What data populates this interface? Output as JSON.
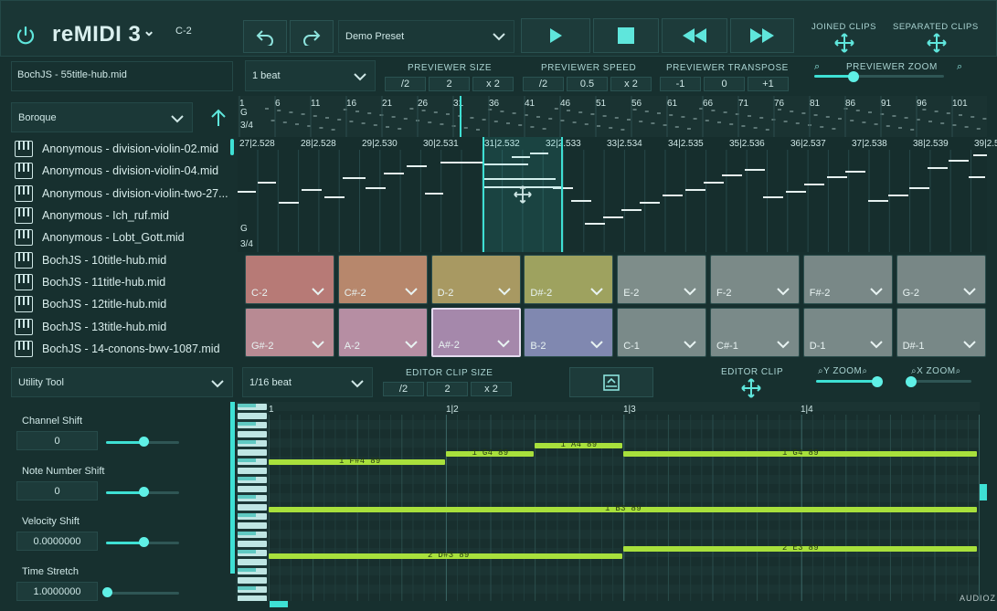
{
  "header": {
    "app_title": "reMIDI 3",
    "title_chevron": "⌄",
    "root_note": "C-2",
    "preset": "Demo Preset",
    "joined_clips": "JOINED CLIPS",
    "separated_clips": "SEPARATED CLIPS"
  },
  "file": {
    "name": "BochJS - 55title-hub.mid"
  },
  "folder": {
    "name": "Boroque"
  },
  "files": [
    "Anonymous - division-violin-02.mid",
    "Anonymous - division-violin-04.mid",
    "Anonymous - division-violin-two-27...",
    "Anonymous - Ich_ruf.mid",
    "Anonymous - Lobt_Gott.mid",
    "BochJS - 10title-hub.mid",
    "BochJS - 11title-hub.mid",
    "BochJS - 12title-hub.mid",
    "BochJS - 13title-hub.mid",
    "BochJS - 14-conons-bwv-1087.mid"
  ],
  "previewer": {
    "grid": "1 beat",
    "size_label": "PREVIEWER SIZE",
    "size_opts": [
      "/2",
      "2",
      "x 2"
    ],
    "speed_label": "PREVIEWER SPEED",
    "speed_opts": [
      "/2",
      "0.5",
      "x 2"
    ],
    "transpose_label": "PREVIEWER TRANSPOSE",
    "transpose_opts": [
      "-1",
      "0",
      "+1"
    ],
    "zoom_label": "PREVIEWER ZOOM",
    "zoom_level": 0.3
  },
  "overview": {
    "clef": "G",
    "meter": "3/4",
    "bars": [
      "1",
      "6",
      "11",
      "16",
      "21",
      "26",
      "31",
      "36",
      "41",
      "46",
      "51",
      "56",
      "61",
      "66",
      "71",
      "76",
      "81",
      "86",
      "91",
      "96",
      "101"
    ]
  },
  "preview_roll": {
    "clef": "G",
    "meter": "3/4",
    "bars": [
      "27|2.528",
      "28|2.528",
      "29|2.530",
      "30|2.531",
      "31|2.532",
      "32|2.533",
      "33|2.534",
      "34|2.535",
      "35|2.536",
      "36|2.537",
      "37|2.538",
      "38|2.539",
      "39|2.5"
    ]
  },
  "pads": [
    {
      "label": "C-2",
      "color": "#b77a76"
    },
    {
      "label": "C#-2",
      "color": "#b7876c"
    },
    {
      "label": "D-2",
      "color": "#a89962"
    },
    {
      "label": "D#-2",
      "color": "#9ea25f"
    },
    {
      "label": "E-2",
      "color": "#7e8d8a"
    },
    {
      "label": "F-2",
      "color": "#7b8a88"
    },
    {
      "label": "F#-2",
      "color": "#798887"
    },
    {
      "label": "G-2",
      "color": "#788786"
    },
    {
      "label": "G#-2",
      "color": "#b88a93"
    },
    {
      "label": "A-2",
      "color": "#b68ea3"
    },
    {
      "label": "A#-2",
      "color": "#a588ab"
    },
    {
      "label": "B-2",
      "color": "#8088b0"
    },
    {
      "label": "C-1",
      "color": "#7a8a89"
    },
    {
      "label": "C#-1",
      "color": "#7a8a89"
    },
    {
      "label": "D-1",
      "color": "#798988"
    },
    {
      "label": "D#-1",
      "color": "#788887"
    }
  ],
  "utility": {
    "tool": "Utility Tool",
    "grid": "1/16 beat",
    "clip_size_label": "EDITOR CLIP SIZE",
    "clip_size_opts": [
      "/2",
      "2",
      "x 2"
    ],
    "editor_clip_label": "EDITOR CLIP",
    "y_zoom_label": "Y ZOOM",
    "x_zoom_label": "X ZOOM",
    "y_zoom_level": 0.95,
    "x_zoom_level": 0.0,
    "params": [
      {
        "label": "Channel Shift",
        "value": "0",
        "level": 0.5
      },
      {
        "label": "Note Number Shift",
        "value": "0",
        "level": 0.5
      },
      {
        "label": "Velocity Shift",
        "value": "0.0000000",
        "level": 0.5
      },
      {
        "label": "Time Stretch",
        "value": "1.0000000",
        "level": 0.0
      }
    ]
  },
  "editor": {
    "bars": [
      "1",
      "1|2",
      "1|3",
      "1|4"
    ],
    "notes": [
      {
        "label": "1 F#4 89",
        "start": 0.0,
        "end": 1.0,
        "row": 0.236
      },
      {
        "label": "1 G4 89",
        "start": 1.0,
        "end": 1.5,
        "row": 0.193
      },
      {
        "label": "1 A4 89",
        "start": 1.5,
        "end": 2.0,
        "row": 0.15
      },
      {
        "label": "1 G4 89",
        "start": 2.0,
        "end": 4.0,
        "row": 0.193
      },
      {
        "label": "1 B3 89",
        "start": 0.0,
        "end": 4.0,
        "row": 0.492
      },
      {
        "label": "2 D#3 89",
        "start": 0.0,
        "end": 2.0,
        "row": 0.742
      },
      {
        "label": "2 E3 89",
        "start": 2.0,
        "end": 4.0,
        "row": 0.705
      }
    ]
  },
  "watermark": "AUDIOZ"
}
